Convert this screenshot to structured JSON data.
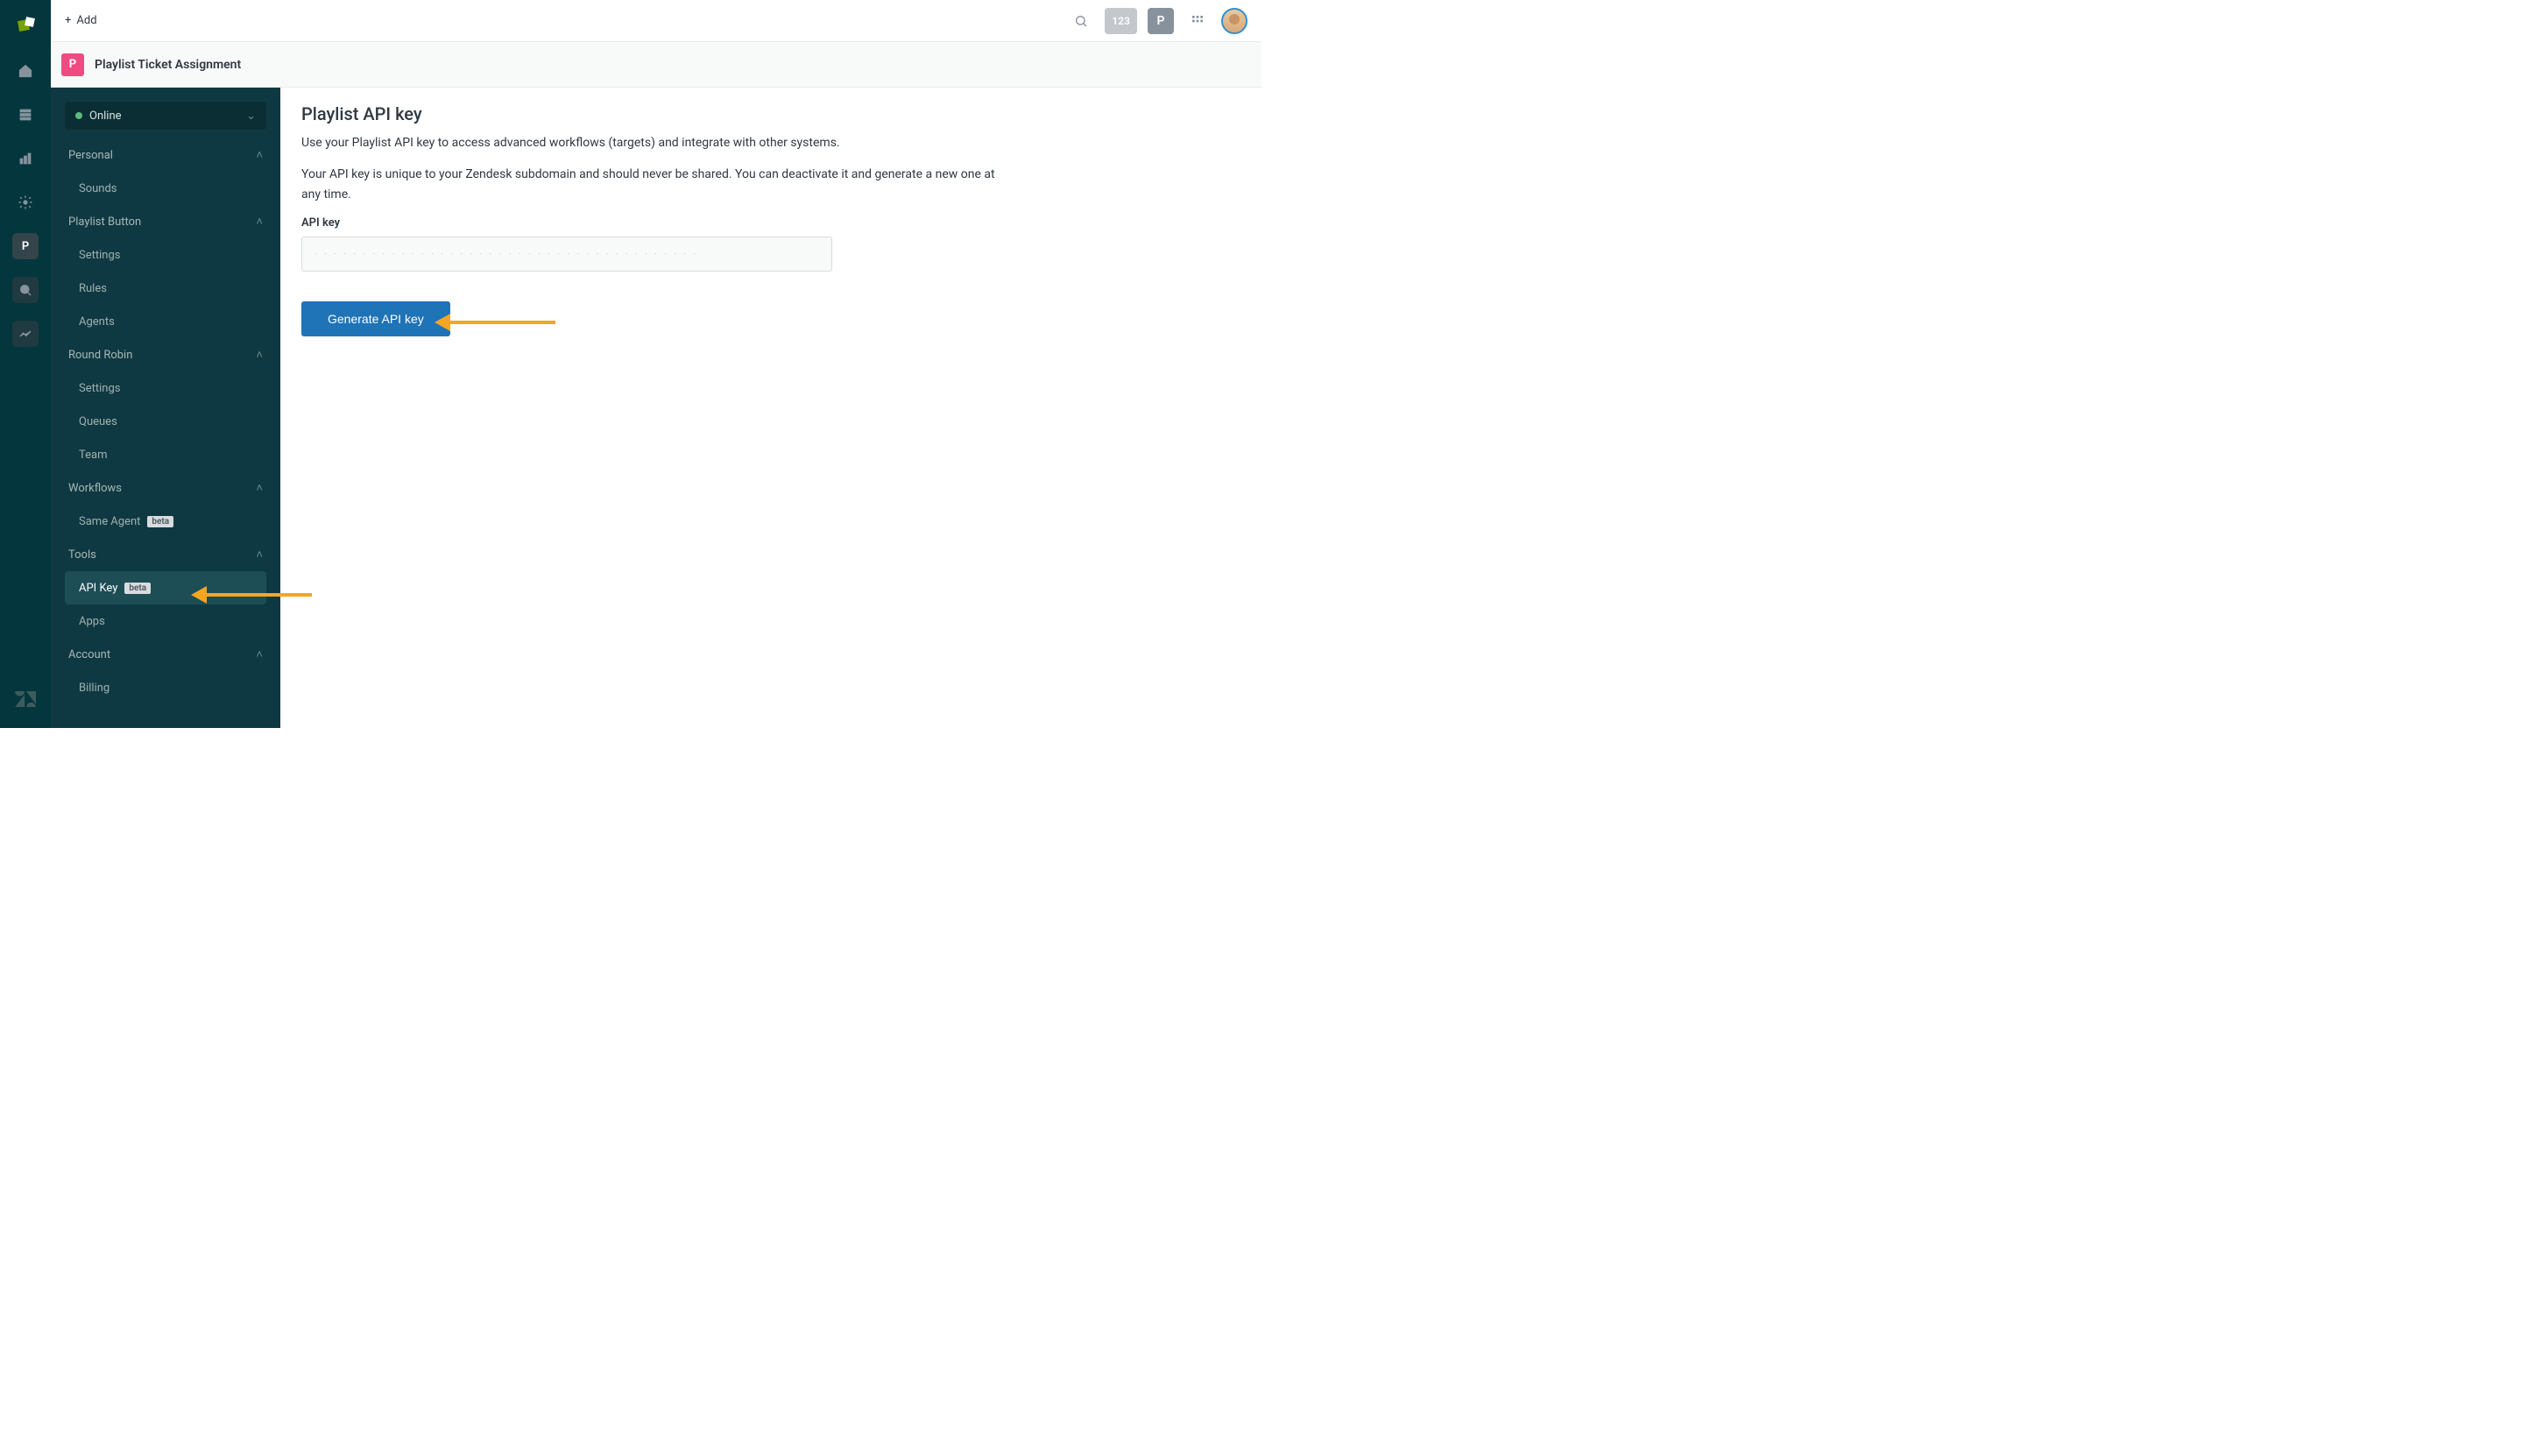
{
  "topbar": {
    "add_label": "Add",
    "chip_123": "123",
    "chip_p": "P"
  },
  "app_header": {
    "icon_letter": "P",
    "title": "Playlist Ticket Assignment"
  },
  "sidebar": {
    "status": "Online",
    "sections": {
      "personal": {
        "label": "Personal",
        "items": [
          "Sounds"
        ]
      },
      "playlist_button": {
        "label": "Playlist Button",
        "items": [
          "Settings",
          "Rules",
          "Agents"
        ]
      },
      "round_robin": {
        "label": "Round Robin",
        "items": [
          "Settings",
          "Queues",
          "Team"
        ]
      },
      "workflows": {
        "label": "Workflows",
        "items": [
          {
            "label": "Same Agent",
            "beta": "beta"
          }
        ]
      },
      "tools": {
        "label": "Tools",
        "items": [
          {
            "label": "API Key",
            "beta": "beta",
            "active": true
          },
          {
            "label": "Apps"
          }
        ]
      },
      "account": {
        "label": "Account",
        "items": [
          "Billing"
        ]
      }
    }
  },
  "content": {
    "heading": "Playlist API key",
    "p1": "Use your Playlist API key to access advanced workflows (targets) and integrate with other systems.",
    "p2": "Your API key is unique to your Zendesk subdomain and should never be shared. You can deactivate it and generate a new one at any time.",
    "field_label": "API key",
    "field_placeholder": "· · · · · · · · · · · · · · · · · · · · · · · · · · · · · · · · · · · · · · · ·",
    "button": "Generate API key"
  }
}
